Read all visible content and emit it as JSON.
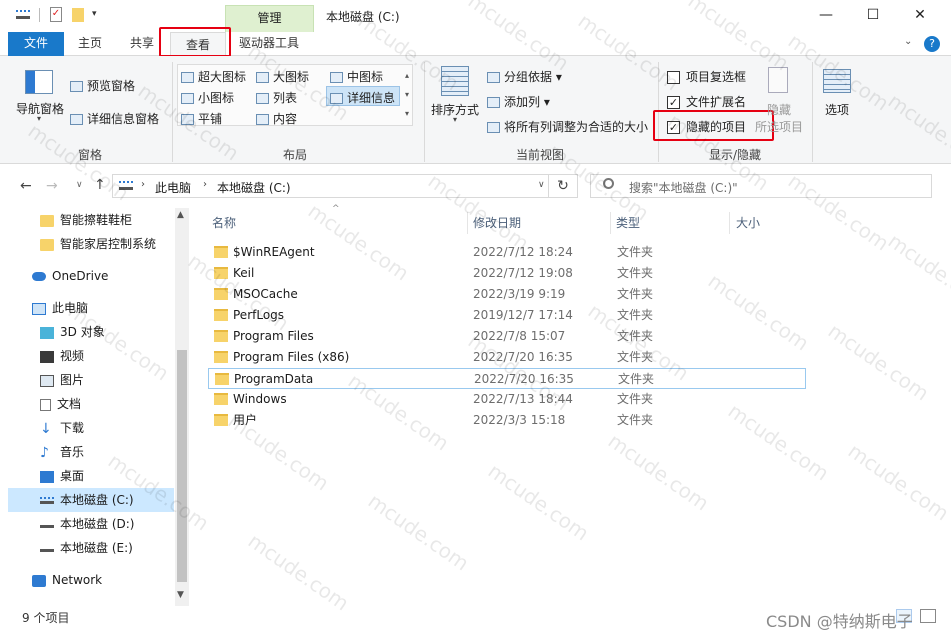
{
  "window": {
    "contextual_tab": "管理",
    "title": "本地磁盘 (C:)",
    "minimize": "—",
    "maximize": "☐",
    "close": "✕"
  },
  "tabs": {
    "file": "文件",
    "home": "主页",
    "share": "共享",
    "view": "查看",
    "drive_tools": "驱动器工具"
  },
  "ribbon": {
    "pane": {
      "nav_pane": "导航窗格",
      "preview_pane": "预览窗格",
      "details_pane": "详细信息窗格",
      "label": "窗格"
    },
    "layout": {
      "extra_large": "超大图标",
      "large": "大图标",
      "medium": "中图标",
      "small": "小图标",
      "list": "列表",
      "details": "详细信息",
      "tiles": "平铺",
      "content": "内容",
      "label": "布局"
    },
    "current_view": {
      "sort_by": "排序方式",
      "group_by": "分组依据",
      "add_columns": "添加列",
      "size_all_columns": "将所有列调整为合适的大小",
      "label": "当前视图"
    },
    "show_hide": {
      "item_checkboxes": "项目复选框",
      "item_checkboxes_checked": false,
      "file_extensions": "文件扩展名",
      "file_extensions_checked": true,
      "hidden_items": "隐藏的项目",
      "hidden_items_checked": true,
      "hide_selected": "隐藏",
      "hide_selected_sub": "所选项目",
      "label": "显示/隐藏"
    },
    "options": "选项"
  },
  "address": {
    "crumb1": "此电脑",
    "crumb2": "本地磁盘 (C:)",
    "refresh": "↻",
    "search_placeholder": "搜索\"本地磁盘 (C:)\""
  },
  "nav": {
    "items": [
      {
        "label": "智能擦鞋鞋柜"
      },
      {
        "label": "智能家居控制系统"
      },
      {
        "label": "OneDrive"
      },
      {
        "label": "此电脑"
      },
      {
        "label": "3D 对象"
      },
      {
        "label": "视频"
      },
      {
        "label": "图片"
      },
      {
        "label": "文档"
      },
      {
        "label": "下载"
      },
      {
        "label": "音乐"
      },
      {
        "label": "桌面"
      },
      {
        "label": "本地磁盘 (C:)"
      },
      {
        "label": "本地磁盘 (D:)"
      },
      {
        "label": "本地磁盘 (E:)"
      },
      {
        "label": "Network"
      }
    ]
  },
  "columns": {
    "name": "名称",
    "date": "修改日期",
    "type": "类型",
    "size": "大小"
  },
  "files": [
    {
      "name": "$WinREAgent",
      "date": "2022/7/12 18:24",
      "type": "文件夹"
    },
    {
      "name": "Keil",
      "date": "2022/7/12 19:08",
      "type": "文件夹"
    },
    {
      "name": "MSOCache",
      "date": "2022/3/19 9:19",
      "type": "文件夹"
    },
    {
      "name": "PerfLogs",
      "date": "2019/12/7 17:14",
      "type": "文件夹"
    },
    {
      "name": "Program Files",
      "date": "2022/7/8 15:07",
      "type": "文件夹"
    },
    {
      "name": "Program Files (x86)",
      "date": "2022/7/20 16:35",
      "type": "文件夹"
    },
    {
      "name": "ProgramData",
      "date": "2022/7/20 16:35",
      "type": "文件夹"
    },
    {
      "name": "Windows",
      "date": "2022/7/13 18:44",
      "type": "文件夹"
    },
    {
      "name": "用户",
      "date": "2022/3/3 15:18",
      "type": "文件夹"
    }
  ],
  "status": {
    "count": "9 个项目"
  },
  "watermark": {
    "text": "mcude.com",
    "credit": "CSDN @特纳斯电子"
  },
  "colors": {
    "accent": "#1979ca",
    "highlight_box": "#e60012",
    "context_tab": "#dff0d0"
  }
}
